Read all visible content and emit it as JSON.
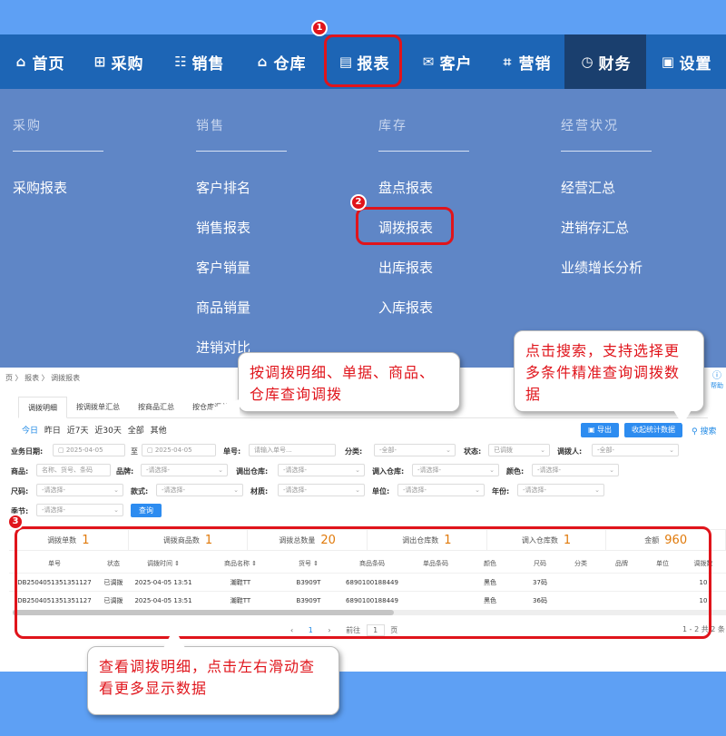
{
  "nav": {
    "items": [
      {
        "icon": "home-icon",
        "glyph": "⌂",
        "label": "首页"
      },
      {
        "icon": "basket-icon",
        "glyph": "⊞",
        "label": "采购"
      },
      {
        "icon": "people-icon",
        "glyph": "☷",
        "label": "销售"
      },
      {
        "icon": "warehouse-icon",
        "glyph": "⌂",
        "label": "仓库"
      },
      {
        "icon": "report-icon",
        "glyph": "▤",
        "label": "报表"
      },
      {
        "icon": "mail-icon",
        "glyph": "✉",
        "label": "客户"
      },
      {
        "icon": "tag-icon",
        "glyph": "⌗",
        "label": "营销"
      },
      {
        "icon": "finance-icon",
        "glyph": "◷",
        "label": "财务"
      },
      {
        "icon": "settings-icon",
        "glyph": "▣",
        "label": "设置"
      }
    ],
    "active": "财务"
  },
  "menu": {
    "columns": [
      {
        "heading": "采购",
        "items": [
          "采购报表"
        ]
      },
      {
        "heading": "销售",
        "items": [
          "客户排名",
          "销售报表",
          "客户销量",
          "商品销量",
          "进销对比"
        ]
      },
      {
        "heading": "库存",
        "items": [
          "盘点报表",
          "调拨报表",
          "出库报表",
          "入库报表"
        ]
      },
      {
        "heading": "经营状况",
        "items": [
          "经营汇总",
          "进销存汇总",
          "业绩增长分析"
        ]
      }
    ]
  },
  "app": {
    "breadcrumb": "页 〉 报表 〉 调拨报表",
    "help": "帮助",
    "tabs": [
      "调拨明细",
      "按调拨单汇总",
      "按商品汇总",
      "按仓库汇总"
    ],
    "quick_dates": [
      "今日",
      "昨日",
      "近7天",
      "近30天",
      "全部",
      "其他"
    ],
    "export_label": "导出",
    "collapse_label": "收起统计数据",
    "search_label": "搜索",
    "filters": {
      "date_label": "业务日期:",
      "date_from": "2025-04-05",
      "date_to_sep": "至",
      "date_to": "2025-04-05",
      "docno_label": "单号:",
      "docno_placeholder": "请输入单号...",
      "category_label": "分类:",
      "category_value": "-全部-",
      "status_label": "状态:",
      "status_value": "已调拨",
      "transferer_label": "调拨人:",
      "transferer_value": "-全部-",
      "goods_label": "商品:",
      "goods_placeholder": "名称、货号、条码",
      "brand_label": "品牌:",
      "brand_value": "-请选择-",
      "outwh_label": "调出仓库:",
      "outwh_value": "-请选择-",
      "inwh_label": "调入仓库:",
      "inwh_value": "-请选择-",
      "color_label": "颜色:",
      "color_value": "-请选择-",
      "size_label": "尺码:",
      "size_value": "-请选择-",
      "style_label": "款式:",
      "style_value": "-请选择-",
      "material_label": "材质:",
      "material_value": "-请选择-",
      "unit_label": "单位:",
      "unit_value": "-请选择-",
      "year_label": "年份:",
      "year_value": "-请选择-",
      "season_label": "季节:",
      "season_value": "-请选择-",
      "query_label": "查询"
    },
    "stats": [
      {
        "label": "调拨单数",
        "value": "1"
      },
      {
        "label": "调拨商品数",
        "value": "1"
      },
      {
        "label": "调拨总数量",
        "value": "20"
      },
      {
        "label": "调出仓库数",
        "value": "1"
      },
      {
        "label": "调入仓库数",
        "value": "1"
      },
      {
        "label": "金额",
        "value": "960"
      }
    ],
    "columns": [
      "单号",
      "状态",
      "调拨时间 ⇕",
      "商品名称 ⇕",
      "货号 ⇕",
      "商品条码",
      "单品条码",
      "颜色",
      "尺码",
      "分类",
      "品牌",
      "单位",
      "调拨数"
    ],
    "rows": [
      [
        "DB2504051351351127",
        "已调拨",
        "2025-04-05 13:51",
        "潮鞋TT",
        "B3909T",
        "6890100188449",
        "",
        "黑色",
        "37码",
        "",
        "",
        "",
        "10"
      ],
      [
        "DB2504051351351127",
        "已调拨",
        "2025-04-05 13:51",
        "潮鞋TT",
        "B3909T",
        "6890100188449",
        "",
        "黑色",
        "36码",
        "",
        "",
        "",
        "10"
      ]
    ],
    "pager": {
      "prev": "‹",
      "page": "1",
      "next": "›",
      "goto_label": "前往",
      "goto_value": "1",
      "page_unit": "页",
      "total": "1 - 2 共 2 条"
    }
  },
  "annotations": {
    "badge1": "1",
    "badge2": "2",
    "badge3": "3",
    "callout_top": "按调拨明细、单据、商品、仓库查询调拨",
    "callout_right": "点击搜索，支持选择更多条件精准查询调拨数据",
    "callout_bottom": "查看调拨明细，点击左右滑动查看更多显示数据"
  }
}
